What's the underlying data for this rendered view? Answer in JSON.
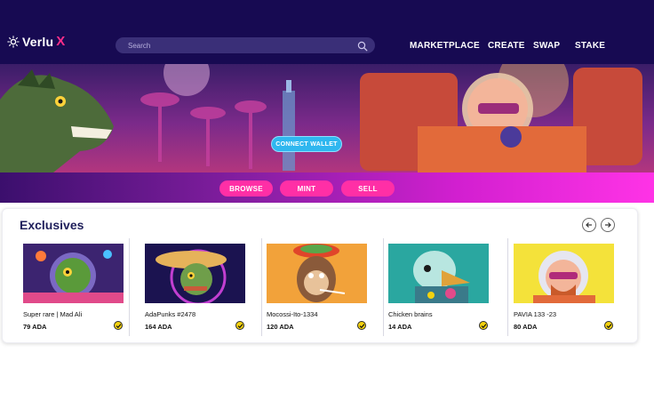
{
  "brand": {
    "name": "Verlu",
    "accent_letter": "X",
    "accent_color": "#ff2e8a"
  },
  "search": {
    "placeholder": "Search"
  },
  "nav": {
    "items": [
      "MARKETPLACE",
      "CREATE",
      "SWAP",
      "STAKE"
    ]
  },
  "hero": {
    "connect_label": "CONNECT WALLET"
  },
  "actions": {
    "browse": "BROWSE",
    "mint": "MINT",
    "sell": "SELL"
  },
  "exclusives": {
    "title": "Exclusives",
    "cards": [
      {
        "title": "Super rare | Mad Ali",
        "price": "79 ADA"
      },
      {
        "title": "AdaPunks #2478",
        "price": "164 ADA"
      },
      {
        "title": "Mocossi-Ito-1334",
        "price": "120 ADA"
      },
      {
        "title": "Chicken brains",
        "price": "14 ADA"
      },
      {
        "title": "PAVIA 133 -23",
        "price": "80 ADA"
      }
    ]
  },
  "colors": {
    "topbar": "#170a52",
    "pill": "#ff2fa6",
    "connect": "#2fb7ef",
    "verified": "#f4d20f"
  }
}
